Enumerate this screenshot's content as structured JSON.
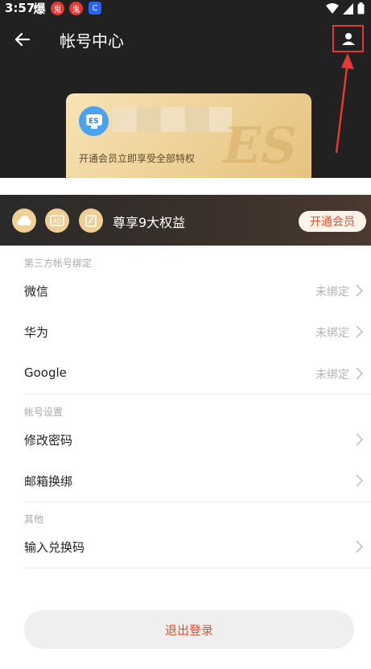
{
  "status_bar": {
    "time": "3:57",
    "notification_1": "爆",
    "notification_2": "鬼",
    "notification_3": "鬼",
    "notification_4": "C"
  },
  "header": {
    "title": "帐号中心",
    "back_icon": "arrow-left-icon",
    "profile_icon": "user-profile-icon"
  },
  "member_card": {
    "promo_text": "开通会员立即享受全部特权",
    "watermark": "ES"
  },
  "benefits": {
    "text": "尊享9大权益",
    "open_button": "开通会员",
    "icons": [
      "cloud-icon",
      "ad-icon",
      "note-icon"
    ]
  },
  "sections": [
    {
      "title": "第三方帐号绑定",
      "rows": [
        {
          "label": "微信",
          "value": "未绑定"
        },
        {
          "label": "华为",
          "value": "未绑定"
        },
        {
          "label": "Google",
          "value": "未绑定"
        }
      ]
    },
    {
      "title": "帐号设置",
      "rows": [
        {
          "label": "修改密码",
          "value": ""
        },
        {
          "label": "邮箱换绑",
          "value": ""
        }
      ]
    },
    {
      "title": "其他",
      "rows": [
        {
          "label": "输入兑换码",
          "value": ""
        }
      ]
    }
  ],
  "logout_button": "退出登录",
  "colors": {
    "header_bg": "#212121",
    "accent": "#e0532f",
    "card_gold": "#eccf93",
    "annotation_red": "#e53935"
  }
}
